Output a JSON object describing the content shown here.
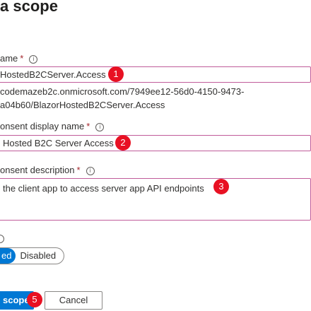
{
  "panel": {
    "title": "a scope"
  },
  "scope_name": {
    "label": "ame",
    "value": "HostedB2CServer.Access",
    "badge": "1"
  },
  "scope_uri": {
    "line1": "codemazeb2c.onmicrosoft.com/7949ee12-56d0-4150-9473-",
    "line2": "a04b60/BlazorHostedB2CServer.Access"
  },
  "consent_display_name": {
    "label": "onsent display name",
    "value": "Hosted B2C Server Access",
    "badge": "2"
  },
  "consent_description": {
    "label": "onsent description",
    "value": "the client app to access server app API endpoints",
    "badge": "3"
  },
  "state": {
    "info": "i",
    "enabled_label": "ed",
    "disabled_label": "Disabled"
  },
  "footer": {
    "add_label": "scope",
    "cancel_label": "Cancel",
    "badge": "5"
  },
  "common": {
    "required_mark": "*",
    "info_glyph": "i"
  },
  "colors": {
    "accent": "#0078d4",
    "badge": "#e81123",
    "field_highlight": "#c05c9a"
  }
}
